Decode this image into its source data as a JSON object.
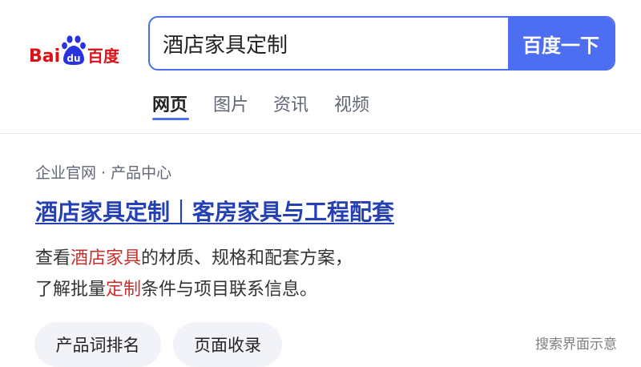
{
  "header": {
    "logo": {
      "brand": "Baidu",
      "paw_text": "du",
      "suffix": "百度",
      "brand_color": "#de0f17",
      "paw_color": "#2932e1"
    },
    "search": {
      "query": "酒店家具定制",
      "button_label": "百度一下",
      "accent": "#4e6ef2"
    },
    "tabs": [
      {
        "label": "网页",
        "active": true
      },
      {
        "label": "图片",
        "active": false
      },
      {
        "label": "资讯",
        "active": false
      },
      {
        "label": "视频",
        "active": false
      }
    ]
  },
  "result": {
    "breadcrumb": "企业官网 · 产品中心",
    "title": "酒店家具定制｜客房家具与工程配套",
    "title_color": "#2440b3",
    "snippet": {
      "line1": {
        "pre": "查看",
        "highlight": "酒店家具",
        "post": "的材质、规格和配套方案，"
      },
      "line2": {
        "pre": "了解批量",
        "highlight": "定制",
        "post": "条件与项目联系信息。"
      },
      "highlight_color": "#c8302e"
    },
    "chips": [
      "产品词排名",
      "页面收录"
    ]
  },
  "footer_note": "搜索界面示意"
}
